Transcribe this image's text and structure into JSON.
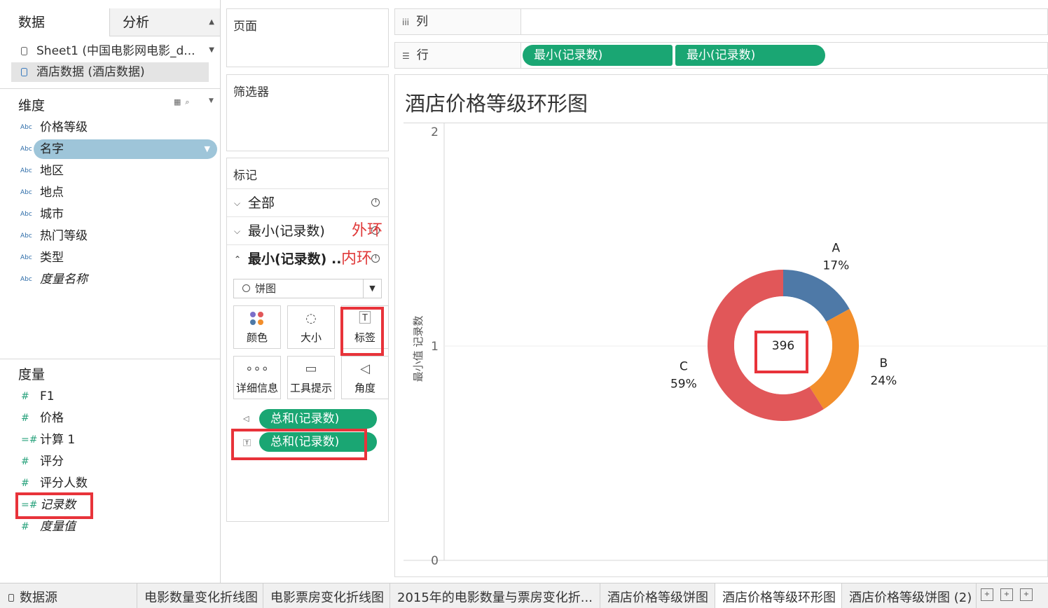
{
  "left_pane": {
    "tabs": {
      "data": "数据",
      "analysis": "分析"
    },
    "data_sources": [
      {
        "label": "Sheet1 (中国电影网电影_d..."
      },
      {
        "label": "酒店数据 (酒店数据)"
      }
    ],
    "dimensions": {
      "title": "维度",
      "items": [
        {
          "label": "价格等级",
          "type": "Abc"
        },
        {
          "label": "名字",
          "type": "Abc"
        },
        {
          "label": "地区",
          "type": "Abc"
        },
        {
          "label": "地点",
          "type": "Abc"
        },
        {
          "label": "城市",
          "type": "Abc"
        },
        {
          "label": "热门等级",
          "type": "Abc"
        },
        {
          "label": "类型",
          "type": "Abc"
        },
        {
          "label": "度量名称",
          "type": "Abc"
        }
      ]
    },
    "measures": {
      "title": "度量",
      "items": [
        {
          "label": "F1",
          "type": "#"
        },
        {
          "label": "价格",
          "type": "#"
        },
        {
          "label": "计算 1",
          "type": "=#"
        },
        {
          "label": "评分",
          "type": "#"
        },
        {
          "label": "评分人数",
          "type": "#"
        },
        {
          "label": "记录数",
          "type": "=#"
        },
        {
          "label": "度量值",
          "type": "#"
        }
      ]
    }
  },
  "cards": {
    "pages": "页面",
    "filters": "筛选器",
    "marks": {
      "title": "标记",
      "rows": {
        "all": "全部",
        "outer": "最小(记录数)",
        "inner": "最小(记录数) .."
      },
      "annotations": {
        "outer": "外环",
        "inner": "内环"
      },
      "mark_type": "饼图",
      "buttons": {
        "color": "颜色",
        "size": "大小",
        "label": "标签",
        "detail": "详细信息",
        "tooltip": "工具提示",
        "angle": "角度"
      },
      "pills": {
        "angle": "总和(记录数)",
        "label": "总和(记录数)"
      }
    }
  },
  "shelves": {
    "columns": {
      "label": "列"
    },
    "rows": {
      "label": "行",
      "pills": [
        "最小(记录数)",
        "最小(记录数)"
      ]
    }
  },
  "viz": {
    "title": "酒店价格等级环形图",
    "y_axis_label": "最小值 记录数"
  },
  "colors": {
    "A": "#4e79a7",
    "B": "#f28e2b",
    "C": "#e15759",
    "pill": "#1aa673",
    "highlight": "#e8333a"
  },
  "chart_data": {
    "type": "pie",
    "title": "酒店价格等级环形图",
    "ylabel": "最小值 记录数",
    "yticks": [
      "0",
      "1",
      "2"
    ],
    "ylim": [
      0,
      2
    ],
    "center_label": "396",
    "categories": [
      "A",
      "B",
      "C"
    ],
    "labels": [
      "17%",
      "24%",
      "59%"
    ],
    "values": [
      17,
      24,
      59
    ],
    "colors": [
      "#4e79a7",
      "#f28e2b",
      "#e15759"
    ]
  },
  "bottom_tabs": {
    "source": "数据源",
    "sheets": [
      "电影数量变化折线图",
      "电影票房变化折线图",
      "2015年的电影数量与票房变化折...",
      "酒店价格等级饼图",
      "酒店价格等级环形图",
      "酒店价格等级饼图 (2)"
    ]
  }
}
